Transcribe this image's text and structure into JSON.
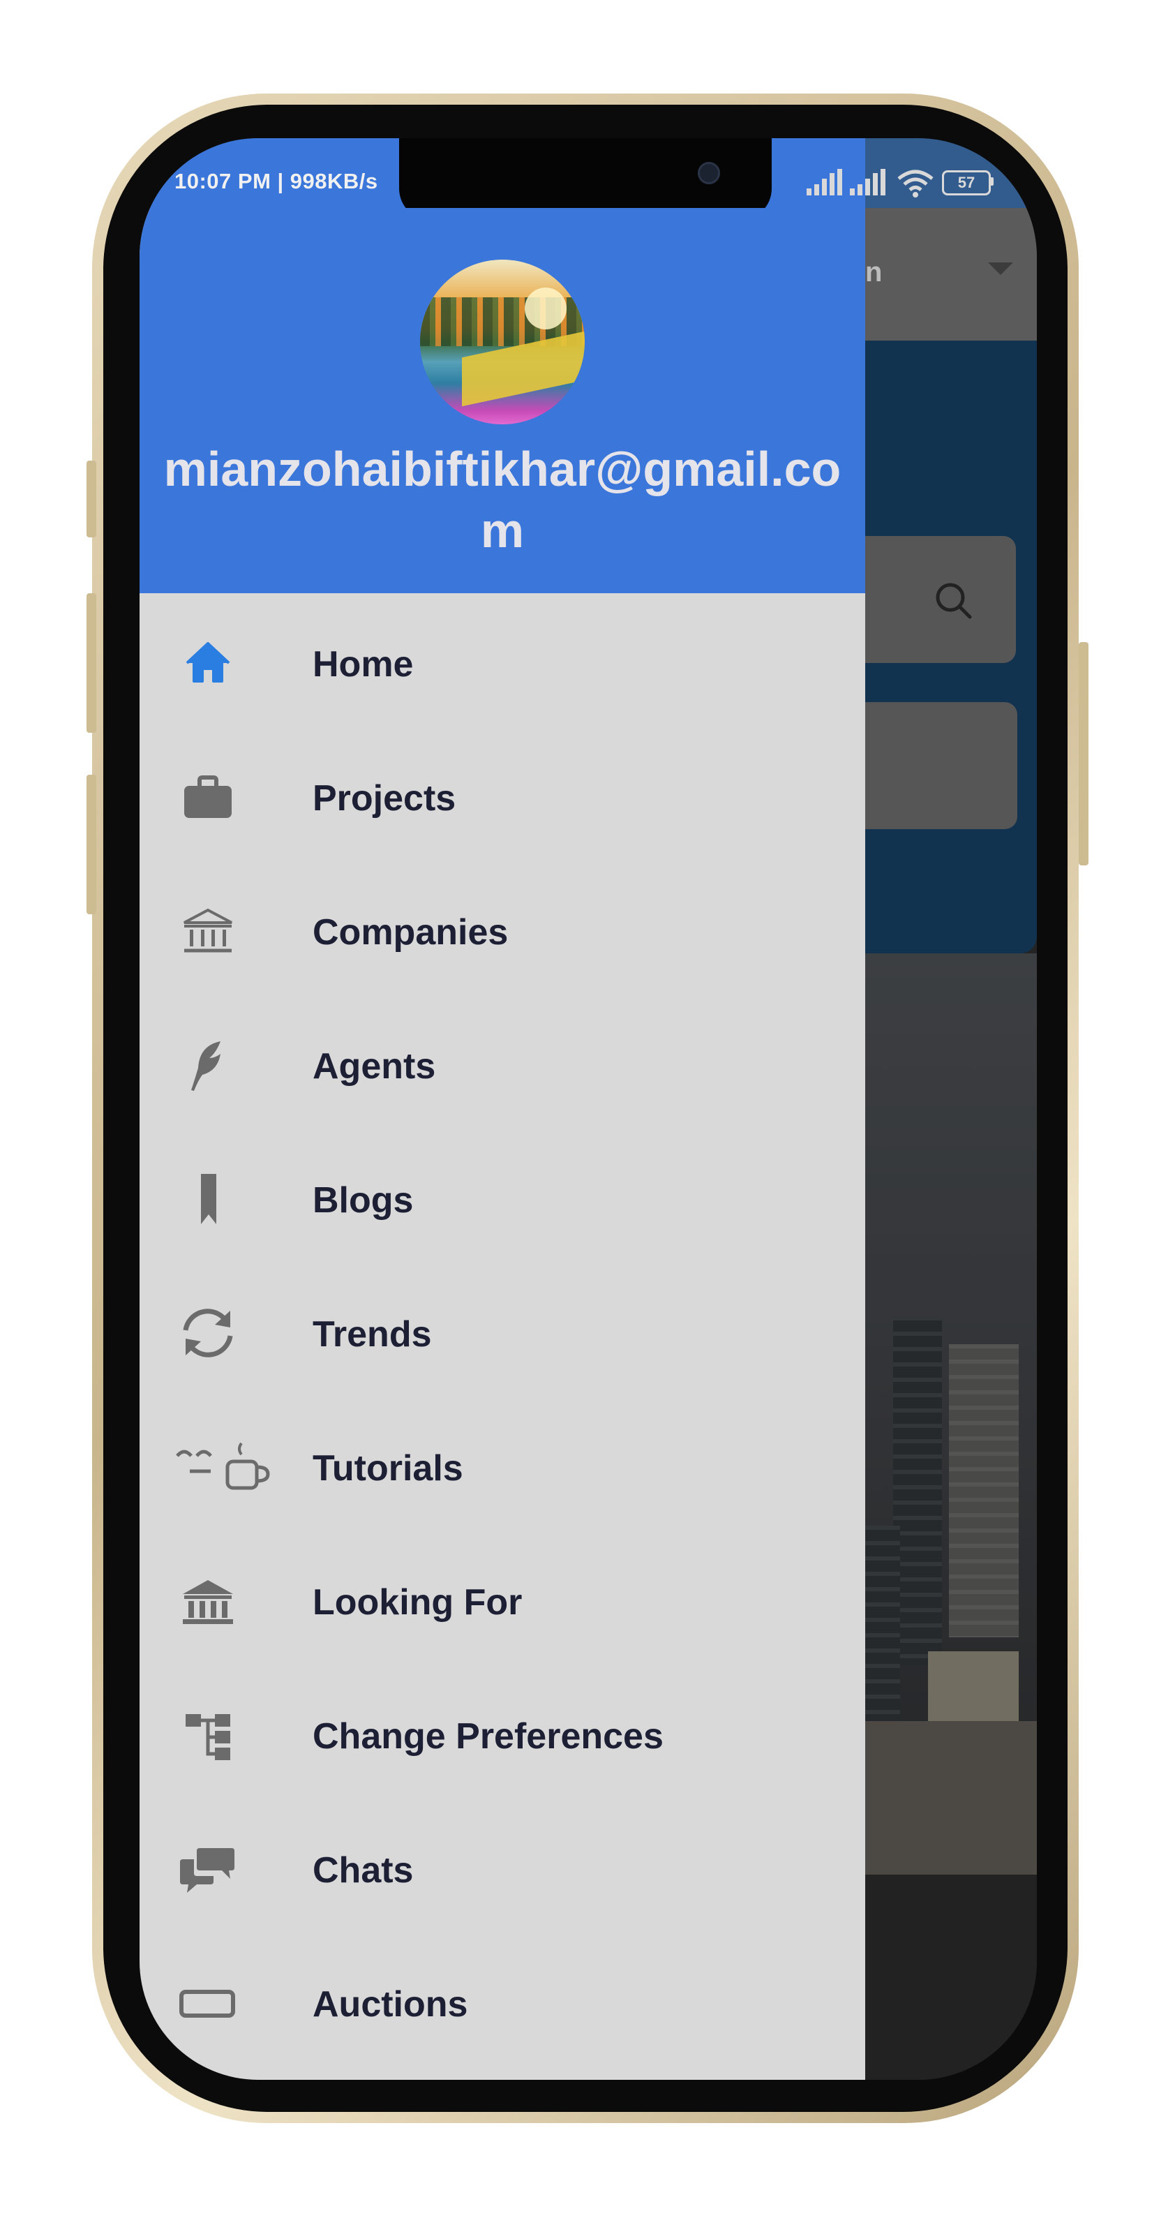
{
  "status_bar": {
    "time_speed": "10:07 PM | 998KB/s",
    "battery": "57"
  },
  "background_app": {
    "toolbar_text": "n"
  },
  "drawer": {
    "email": "mianzohaibiftikhar@gmail.com",
    "items": [
      {
        "label": "Home",
        "icon": "home-icon",
        "color": "#2a7de1"
      },
      {
        "label": "Projects",
        "icon": "briefcase-icon",
        "color": "#6b6b6b"
      },
      {
        "label": "Companies",
        "icon": "bank-icon",
        "color": "#6b6b6b"
      },
      {
        "label": "Agents",
        "icon": "feather-icon",
        "color": "#6b6b6b"
      },
      {
        "label": "Blogs",
        "icon": "bookmark-icon",
        "color": "#6b6b6b"
      },
      {
        "label": "Trends",
        "icon": "refresh-icon",
        "color": "#6b6b6b"
      },
      {
        "label": "Tutorials",
        "icon": "coffee-break-icon",
        "color": "#6b6b6b"
      },
      {
        "label": "Looking For",
        "icon": "institution-icon",
        "color": "#6b6b6b"
      },
      {
        "label": "Change Preferences",
        "icon": "sitemap-icon",
        "color": "#6b6b6b"
      },
      {
        "label": "Chats",
        "icon": "chat-bubbles-icon",
        "color": "#6b6b6b"
      },
      {
        "label": "Auctions",
        "icon": "rectangle-icon",
        "color": "#6b6b6b"
      }
    ]
  }
}
